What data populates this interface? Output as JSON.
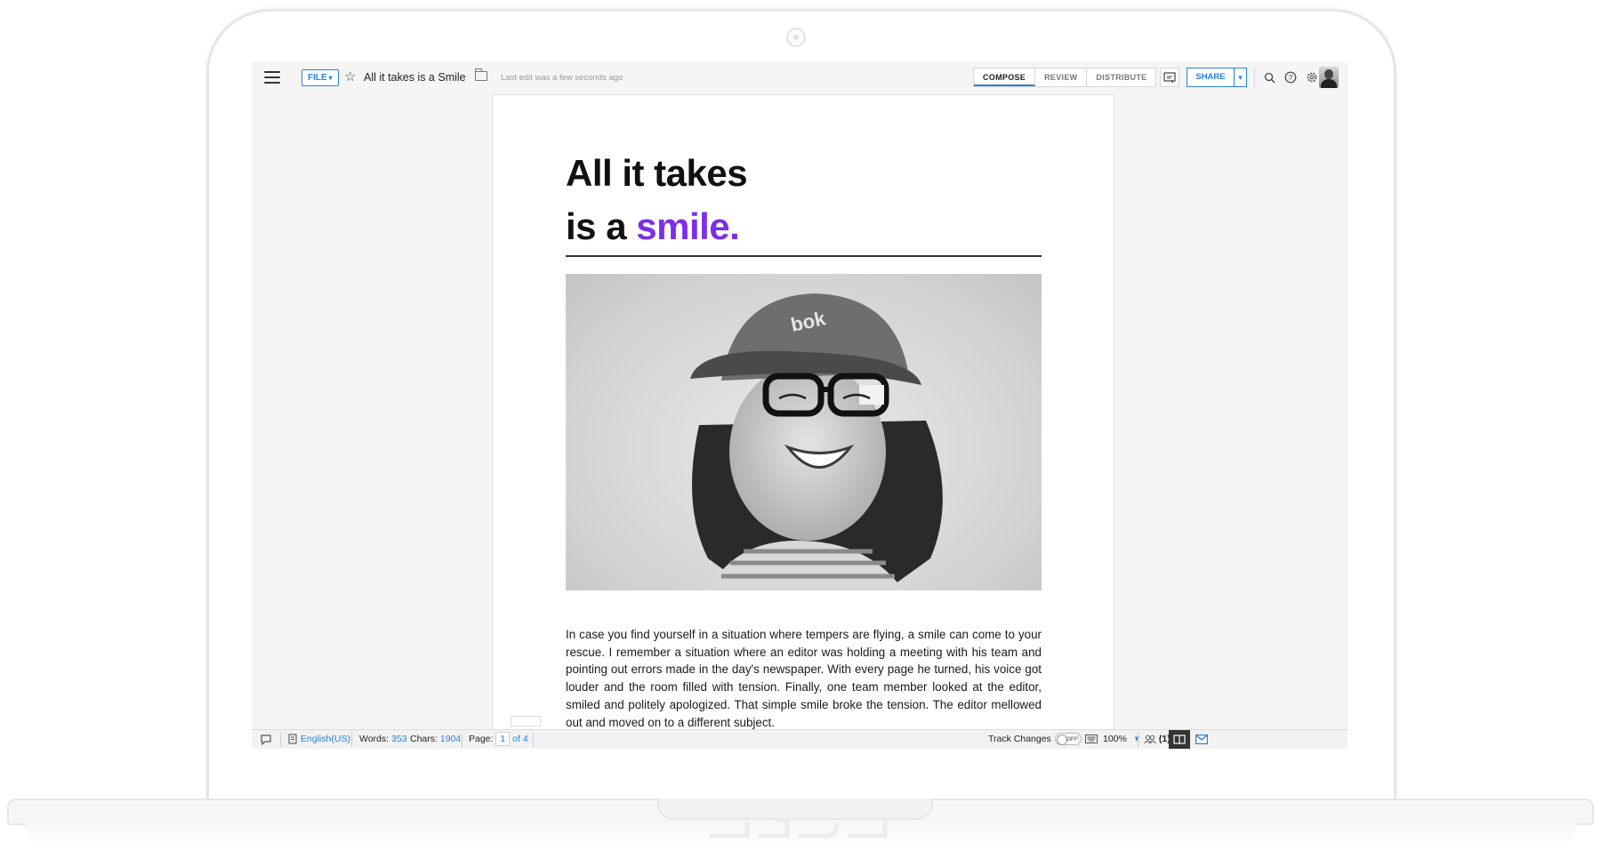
{
  "toolbar": {
    "file_label": "FILE",
    "doc_title": "All it takes is a Smile",
    "last_edit": "Last edit was a few seconds ago",
    "tabs": [
      {
        "label": "COMPOSE",
        "active": true
      },
      {
        "label": "REVIEW",
        "active": false
      },
      {
        "label": "DISTRIBUTE",
        "active": false
      }
    ],
    "share_label": "SHARE",
    "icons": [
      "menu-icon",
      "star-icon",
      "folder-icon",
      "present-icon",
      "search-icon",
      "help-icon",
      "gear-icon",
      "avatar"
    ]
  },
  "document": {
    "headline_line1": "All it takes",
    "headline_line2_plain": "is a ",
    "headline_line2_accent": "smile.",
    "accent_color": "#7b2fe8",
    "body": "In case you find yourself in a situation where tempers are flying, a smile can come to your rescue. I remember a situation where an editor was holding a meeting with his team and pointing out errors made in the day's newspaper. With every page he turned, his voice got louder and the room filled with tension. Finally, one team member looked at the editor, smiled and politely apologized. That simple smile broke the tension. The editor mellowed out and moved on to a different subject."
  },
  "statusbar": {
    "language": "English(US)",
    "words_label": "Words:",
    "words_value": "353",
    "chars_label": "Chars:",
    "chars_value": "1904",
    "page_label": "Page:",
    "page_value": "1",
    "page_of": "of 4",
    "track_changes_label": "Track Changes",
    "track_changes_state": "OFF",
    "zoom": "100%",
    "collaborators": "(1)"
  },
  "colors": {
    "brand_blue": "#2b7fd8",
    "accent_purple": "#7b2fe8"
  }
}
